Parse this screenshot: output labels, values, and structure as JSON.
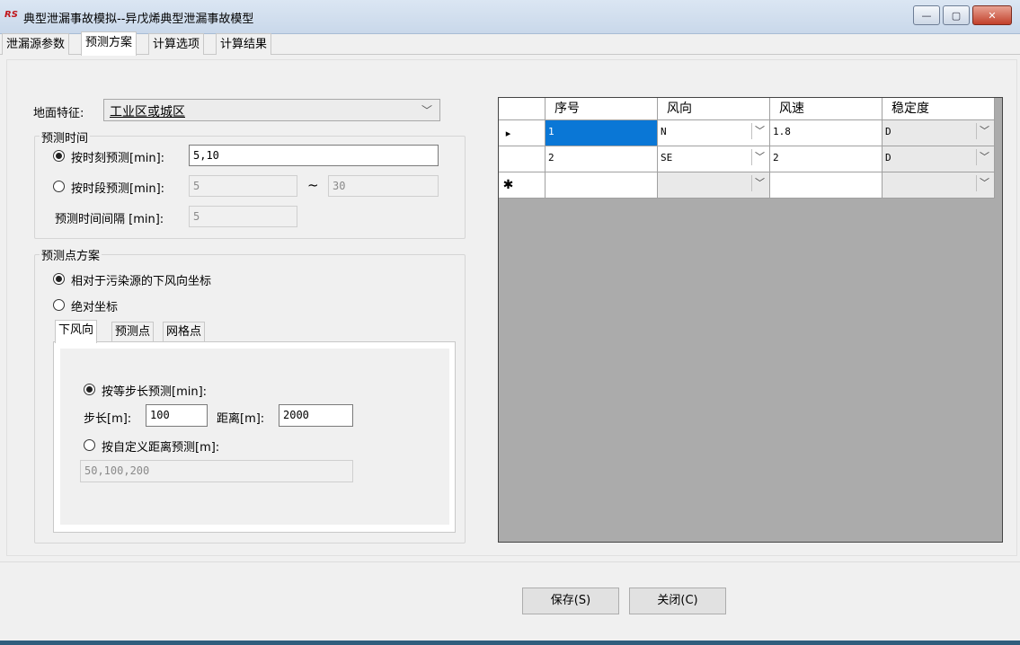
{
  "window": {
    "app_icon_text": "RS",
    "title": "典型泄漏事故模拟--异戊烯典型泄漏事故模型",
    "controls": {
      "minimize": "—",
      "maximize": "▢",
      "close": "✕"
    }
  },
  "tabs": [
    {
      "label": "泄漏源参数",
      "active": false
    },
    {
      "label": "预测方案",
      "active": true
    },
    {
      "label": "计算选项",
      "active": false
    },
    {
      "label": "计算结果",
      "active": false
    }
  ],
  "terrain": {
    "label": "地面特征:",
    "value": "工业区或城区",
    "icon": "chevron-down-icon"
  },
  "forecast_time": {
    "group_title": "预测时间",
    "by_time_label": "按时刻预测[min]:",
    "by_time_value": "5,10",
    "by_period_label": "按时段预测[min]:",
    "period_start": "5",
    "period_sep": "~",
    "period_end": "30",
    "interval_label": "预测时间间隔 [min]:",
    "interval_value": "5",
    "selected": "by_time"
  },
  "forecast_points": {
    "group_title": "预测点方案",
    "relative_label": "相对于污染源的下风向坐标",
    "absolute_label": "绝对坐标",
    "selected": "relative",
    "inner_tabs": [
      {
        "label": "下风向",
        "active": true
      },
      {
        "label": "预测点",
        "active": false
      },
      {
        "label": "网格点",
        "active": false
      }
    ],
    "step_label": "按等步长预测[min]:",
    "step_len_label": "步长[m]:",
    "step_len_value": "100",
    "distance_label": "距离[m]:",
    "distance_value": "2000",
    "custom_label": "按自定义距离预测[m]:",
    "custom_value": "50,100,200",
    "selected_mode": "step"
  },
  "grid": {
    "columns": [
      "序号",
      "风向",
      "风速",
      "稳定度"
    ],
    "rows": [
      {
        "indicator": "▸",
        "no": "1",
        "direction": "N",
        "speed": "1.8",
        "stability": "D"
      },
      {
        "indicator": "",
        "no": "2",
        "direction": "SE",
        "speed": "2",
        "stability": "D"
      }
    ],
    "new_row_indicator": "✱"
  },
  "buttons": {
    "save": "保存(S)",
    "close": "关闭(C)"
  }
}
